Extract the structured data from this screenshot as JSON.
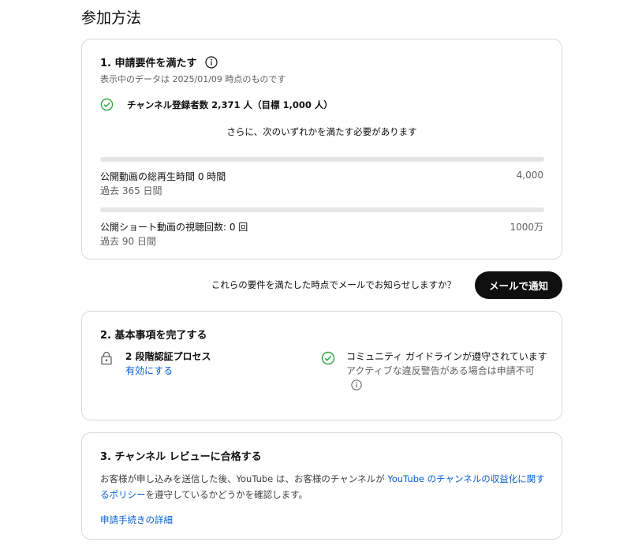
{
  "page_title": "参加方法",
  "requirements": {
    "title": "1. 申請要件を満たす",
    "data_as_of": "表示中のデータは 2025/01/09 時点のものです",
    "subscribers_text": "チャンネル登録者数 2,371 人（目標 1,000 人）",
    "either_text": "さらに、次のいずれかを満たす必要があります",
    "watch_hours": {
      "label": "公開動画の総再生時間 0 時間",
      "period": "過去 365 日間",
      "goal": "4,000",
      "progress": 0
    },
    "shorts_views": {
      "label": "公開ショート動画の視聴回数: 0 回",
      "period": "過去 90 日間",
      "goal": "1000万",
      "progress": 0
    }
  },
  "notify": {
    "question": "これらの要件を満たした時点でメールでお知らせしますか？",
    "button_label": "メールで通知"
  },
  "basics": {
    "title": "2. 基本事項を完了する",
    "two_step": {
      "label": "2 段階認証プロセス",
      "link": "有効にする"
    },
    "guidelines": {
      "label": "コミュニティ ガイドラインが遵守されています",
      "note": "アクティブな違反警告がある場合は申請不可"
    }
  },
  "review": {
    "title": "3. チャンネル レビューに合格する",
    "desc_before": "お客様が申し込みを送信した後、YouTube は、お客様のチャンネルが ",
    "desc_link": "YouTube のチャンネルの収益化に関するポリシー",
    "desc_after": "を遵守しているかどうかを確認します。",
    "details_link": "申請手続きの詳細"
  },
  "colors": {
    "check_green": "#2ba640",
    "link_blue": "#065fd4"
  }
}
